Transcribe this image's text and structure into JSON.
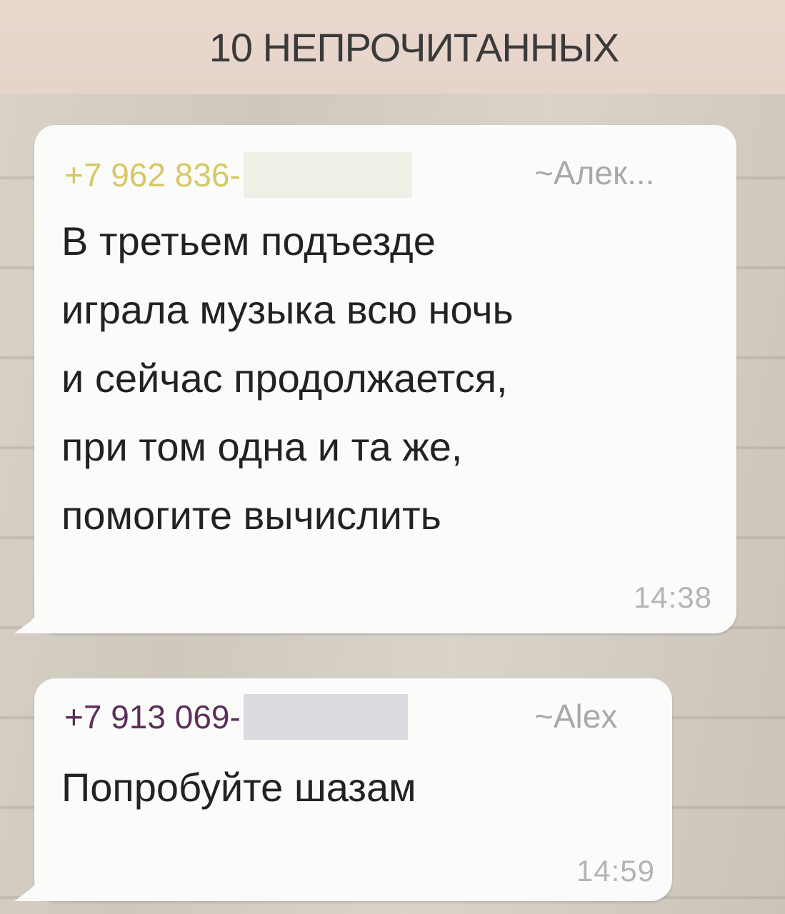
{
  "banner": {
    "unread_label": "10 НЕПРОЧИТАННЫХ"
  },
  "messages": [
    {
      "sender_phone": "+7 962 836-",
      "sender_alias": "~Алек...",
      "text": "В третьем подъезде\nиграла музыка всю ночь\nи сейчас продолжается,\nпри том одна и та же,\nпомогите вычислить",
      "time": "14:38",
      "sender_color": "#d6c866"
    },
    {
      "sender_phone": "+7 913 069-",
      "sender_alias": "~Alex",
      "text": "Попробуйте шазам",
      "time": "14:59",
      "sender_color": "#5b2f58"
    }
  ]
}
